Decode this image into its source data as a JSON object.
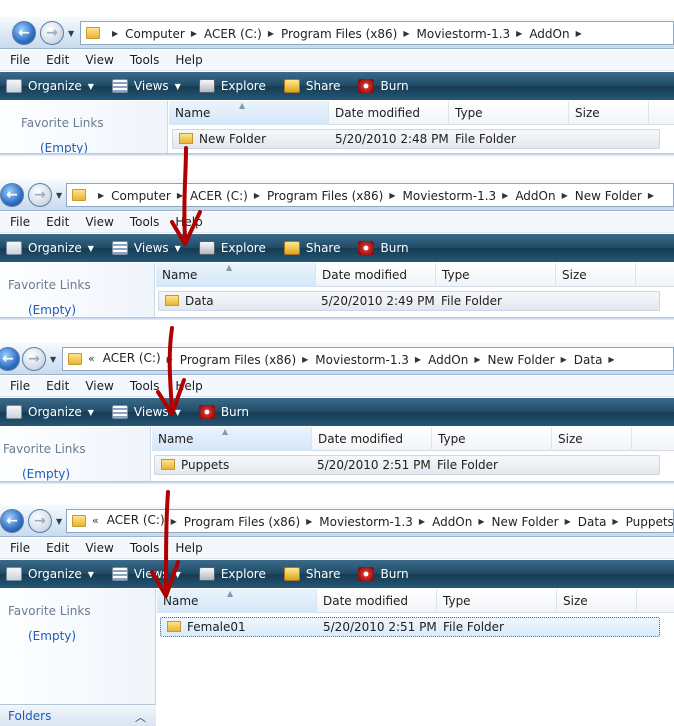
{
  "nav": {
    "back_icon": "back-arrow-icon",
    "forward_icon": "forward-arrow-icon"
  },
  "menu": [
    "File",
    "Edit",
    "View",
    "Tools",
    "Help"
  ],
  "toolbar": {
    "organize": "Organize",
    "views": "Views",
    "explore": "Explore",
    "share": "Share",
    "burn": "Burn"
  },
  "nav_pane": {
    "favorite_links": "Favorite Links",
    "empty": "(Empty)"
  },
  "columns": {
    "name": "Name",
    "date": "Date modified",
    "type": "Type",
    "size": "Size"
  },
  "folders_bar": {
    "label": "Folders"
  },
  "windows": [
    {
      "breadcrumbs": [
        "Computer",
        "ACER (C:)",
        "Program Files (x86)",
        "Moviestorm-1.3",
        "AddOn"
      ],
      "overflow": false,
      "row": {
        "name": "New Folder",
        "date": "5/20/2010 2:48 PM",
        "type": "File Folder",
        "size": ""
      }
    },
    {
      "breadcrumbs": [
        "Computer",
        "ACER (C:)",
        "Program Files (x86)",
        "Moviestorm-1.3",
        "AddOn",
        "New Folder"
      ],
      "overflow": false,
      "row": {
        "name": "Data",
        "date": "5/20/2010 2:49 PM",
        "type": "File Folder",
        "size": ""
      }
    },
    {
      "breadcrumbs": [
        "ACER (C:)",
        "Program Files (x86)",
        "Moviestorm-1.3",
        "AddOn",
        "New Folder",
        "Data"
      ],
      "overflow": true,
      "row": {
        "name": "Puppets",
        "date": "5/20/2010 2:51 PM",
        "type": "File Folder",
        "size": ""
      }
    },
    {
      "breadcrumbs": [
        "ACER (C:)",
        "Program Files (x86)",
        "Moviestorm-1.3",
        "AddOn",
        "New Folder",
        "Data",
        "Puppets"
      ],
      "overflow": true,
      "row": {
        "name": "Female01",
        "date": "5/20/2010 2:51 PM",
        "type": "File Folder",
        "size": ""
      }
    }
  ],
  "overflow_marker": "«",
  "annotation_color": "#b00000"
}
